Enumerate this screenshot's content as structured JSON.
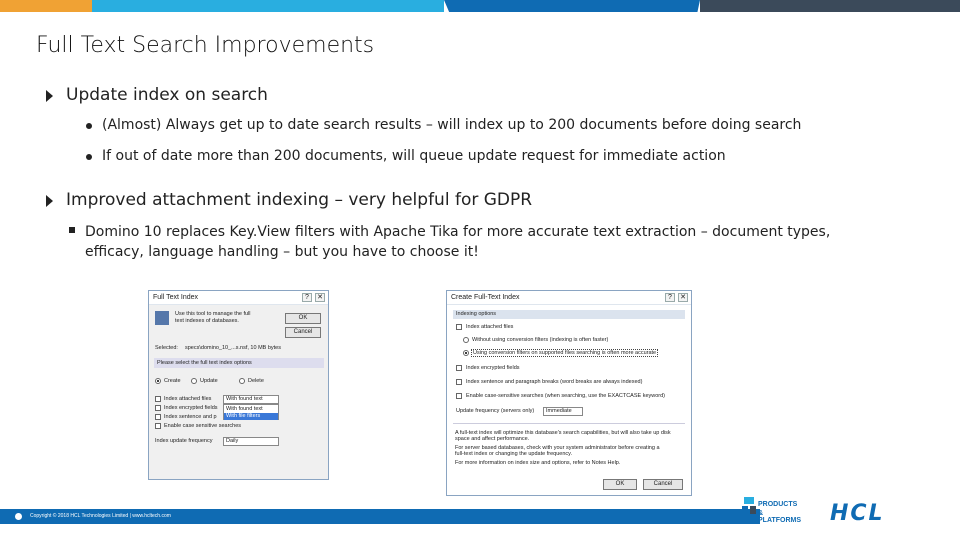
{
  "slide": {
    "title": "Full Text Search Improvements",
    "bullets": [
      {
        "text": "Update index on search",
        "sub": [
          "(Almost) Always get up to date search results – will index up to 200 documents before doing search",
          "If out of date more than 200 documents, will queue update request for immediate action"
        ]
      },
      {
        "text": "Improved attachment indexing – very helpful for GDPR",
        "sub": [
          "Domino 10 replaces Key.View filters with Apache Tika for more accurate text extraction – document types, efficacy, language handling – but you have to choose it!"
        ]
      }
    ]
  },
  "dialog1": {
    "title": "Full Text Index",
    "intro": [
      "Use this tool to manage the full",
      "text indexes of databases."
    ],
    "ok": "OK",
    "cancel": "Cancel",
    "selected_label": "Selected:",
    "selected_value": "specs\\domino_10_...s.nsf, 10 MB bytes",
    "select_options_label": "Please select the full text index options",
    "radios": [
      "Create",
      "Update",
      "Delete"
    ],
    "checkboxes": [
      "Index attached files",
      "Index encrypted fields",
      "Index sentence and p",
      "Enable case sensitive searches"
    ],
    "attach_select": "With found text",
    "attach_options": [
      "With found text",
      "With file filters"
    ],
    "freq_label": "Index update frequency",
    "freq_value": "Daily"
  },
  "dialog2": {
    "title": "Create Full-Text Index",
    "group": "Indexing options",
    "index_attached": "Index attached files",
    "radio1": "Without using conversion filters (indexing is often faster)",
    "radio2": "Using conversion filters on supported files searching is often more accurate",
    "checks": [
      "Index encrypted fields",
      "Index sentence and paragraph breaks (word breaks are always indexed)",
      "Enable case-sensitive searches (when searching, use the EXACTCASE keyword)"
    ],
    "freq_label": "Update frequency (servers only)",
    "freq_value": "Immediate",
    "notes": [
      "A full-text index will optimize this database's search capabilities, but will also take up disk",
      "space and affect performance.",
      "For server based databases, check with your system administrator before creating a",
      "full-text index or changing the update frequency.",
      "For more information on index size and options, refer to Notes Help."
    ],
    "ok": "OK",
    "cancel": "Cancel"
  },
  "footer": {
    "copyright": "Copyright © 2018 HCL Technologies Limited  |  www.hcltech.com"
  },
  "logos": {
    "pp_line1": "PRODUCTS",
    "pp_line2": "& PLATFORMS",
    "hcl": "HCL"
  },
  "colors": {
    "blue": "#0f6bb3",
    "orange": "#f0a234",
    "cyan": "#29aee0",
    "dark": "#3b4a5a"
  }
}
